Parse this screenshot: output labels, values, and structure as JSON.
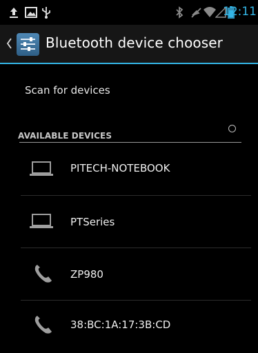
{
  "status_bar": {
    "time": "12:11",
    "icons": [
      "usb-upload-icon",
      "image-icon",
      "usb-icon",
      "bluetooth-icon",
      "mute-icon",
      "wifi-icon",
      "signal-icon",
      "battery-icon"
    ]
  },
  "action_bar": {
    "title": "Bluetooth device chooser"
  },
  "scan": {
    "label": "Scan for devices"
  },
  "available": {
    "header": "AVAILABLE DEVICES"
  },
  "devices": [
    {
      "name": "PITECH-NOTEBOOK",
      "icon": "laptop-icon"
    },
    {
      "name": "PTSeries",
      "icon": "laptop-icon"
    },
    {
      "name": "ZP980",
      "icon": "phone-icon"
    },
    {
      "name": "38:BC:1A:17:3B:CD",
      "icon": "phone-icon"
    }
  ],
  "colors": {
    "accent": "#33b5e5",
    "background": "#000000",
    "action_bar": "#161616"
  }
}
